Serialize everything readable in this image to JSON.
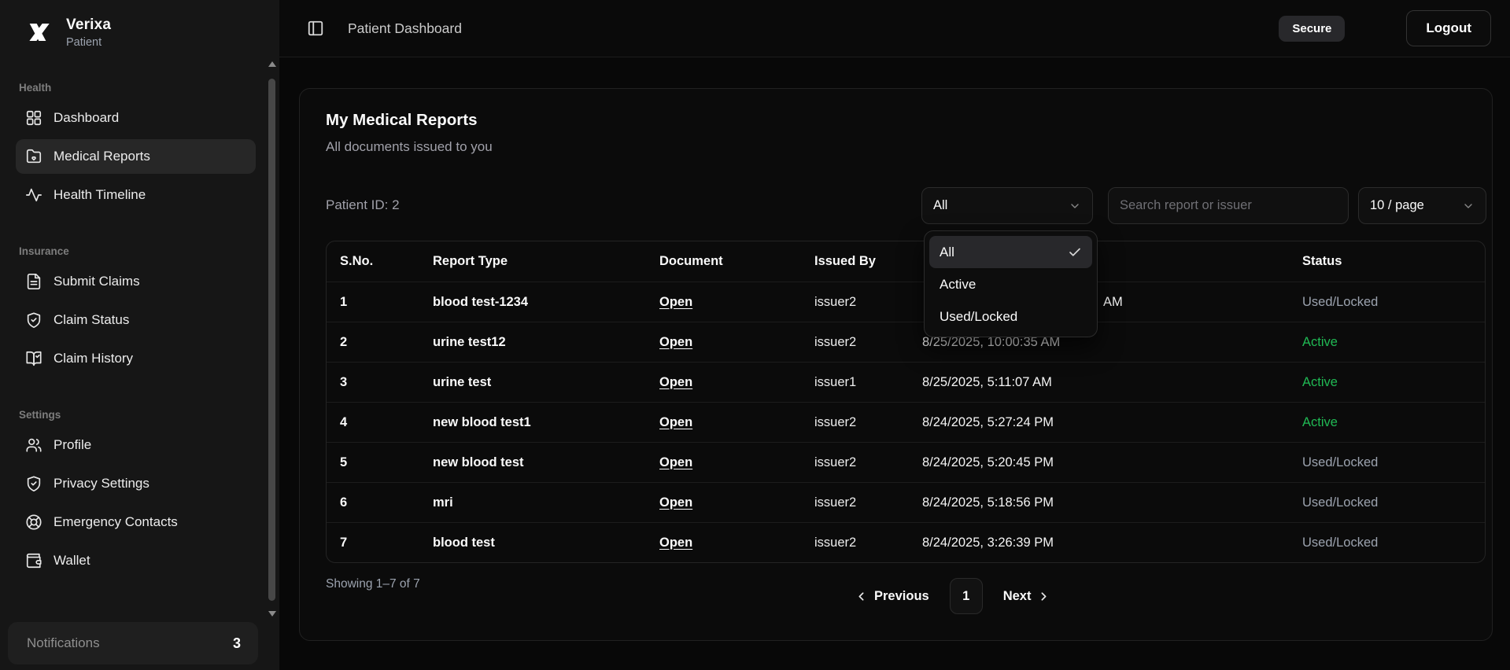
{
  "brand": {
    "name": "Verixa",
    "role": "Patient"
  },
  "topbar": {
    "title": "Patient Dashboard",
    "secure_badge": "Secure",
    "logout_label": "Logout"
  },
  "sidebar": {
    "sections": [
      {
        "label": "Health",
        "items": [
          {
            "label": "Dashboard",
            "icon": "dashboard-grid",
            "active": false
          },
          {
            "label": "Medical Reports",
            "icon": "folder-heart",
            "active": true
          },
          {
            "label": "Health Timeline",
            "icon": "activity",
            "active": false
          }
        ]
      },
      {
        "label": "Insurance",
        "items": [
          {
            "label": "Submit Claims",
            "icon": "file-text",
            "active": false
          },
          {
            "label": "Claim Status",
            "icon": "shield-check",
            "active": false
          },
          {
            "label": "Claim History",
            "icon": "book-check",
            "active": false
          }
        ]
      },
      {
        "label": "Settings",
        "items": [
          {
            "label": "Profile",
            "icon": "users",
            "active": false
          },
          {
            "label": "Privacy Settings",
            "icon": "shield-check",
            "active": false
          },
          {
            "label": "Emergency Contacts",
            "icon": "life-buoy",
            "active": false
          },
          {
            "label": "Wallet",
            "icon": "wallet",
            "active": false
          }
        ]
      }
    ],
    "notifications": {
      "label": "Notifications",
      "count": "3"
    }
  },
  "card": {
    "title": "My Medical Reports",
    "subtitle": "All documents issued to you",
    "patient_id": "Patient ID: 2",
    "filters": {
      "status_filter_value": "All",
      "search_placeholder": "Search report or issuer",
      "page_size_value": "10 / page"
    },
    "status_dropdown": {
      "options": [
        {
          "label": "All",
          "selected": true
        },
        {
          "label": "Active",
          "selected": false
        },
        {
          "label": "Used/Locked",
          "selected": false
        }
      ]
    },
    "table": {
      "headers": [
        "S.No.",
        "Report Type",
        "Document",
        "Issued By",
        "",
        "Status"
      ],
      "rows": [
        {
          "sno": "1",
          "report_type": "blood test-1234",
          "document": "Open",
          "issued_by": "issuer2",
          "issued_at": "AM",
          "issued_at_occluded": true,
          "status": "Used/Locked",
          "status_kind": "locked"
        },
        {
          "sno": "2",
          "report_type": "urine test12",
          "document": "Open",
          "issued_by": "issuer2",
          "issued_at": "8/25/2025, 10:00:35 AM",
          "issued_at_occluded": false,
          "status": "Active",
          "status_kind": "active"
        },
        {
          "sno": "3",
          "report_type": "urine test",
          "document": "Open",
          "issued_by": "issuer1",
          "issued_at": "8/25/2025, 5:11:07 AM",
          "issued_at_occluded": false,
          "status": "Active",
          "status_kind": "active"
        },
        {
          "sno": "4",
          "report_type": "new blood test1",
          "document": "Open",
          "issued_by": "issuer2",
          "issued_at": "8/24/2025, 5:27:24 PM",
          "issued_at_occluded": false,
          "status": "Active",
          "status_kind": "active"
        },
        {
          "sno": "5",
          "report_type": "new blood test",
          "document": "Open",
          "issued_by": "issuer2",
          "issued_at": "8/24/2025, 5:20:45 PM",
          "issued_at_occluded": false,
          "status": "Used/Locked",
          "status_kind": "locked"
        },
        {
          "sno": "6",
          "report_type": "mri",
          "document": "Open",
          "issued_by": "issuer2",
          "issued_at": "8/24/2025, 5:18:56 PM",
          "issued_at_occluded": false,
          "status": "Used/Locked",
          "status_kind": "locked"
        },
        {
          "sno": "7",
          "report_type": "blood test",
          "document": "Open",
          "issued_by": "issuer2",
          "issued_at": "8/24/2025, 3:26:39 PM",
          "issued_at_occluded": false,
          "status": "Used/Locked",
          "status_kind": "locked"
        }
      ]
    },
    "footer": {
      "showing_text": "Showing 1–7 of 7",
      "prev_label": "Previous",
      "page": "1",
      "next_label": "Next"
    }
  },
  "colors": {
    "active_green": "#20b954",
    "muted_gray": "#9ca3af",
    "sidebar_bg": "#161616",
    "card_bg": "#0b0b0b"
  }
}
